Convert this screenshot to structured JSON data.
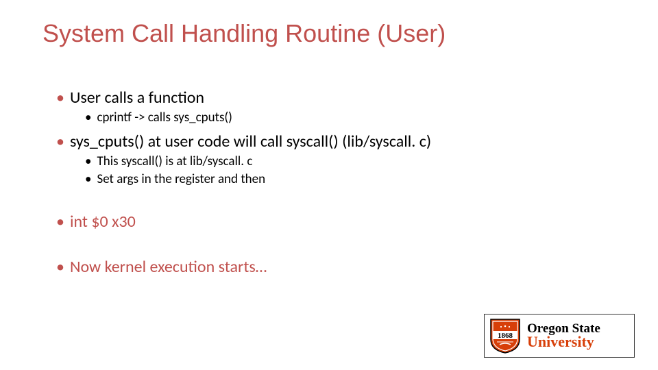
{
  "title": "System Call Handling Routine (User)",
  "bullets": {
    "b1": "User calls a function",
    "b1a": "cprintf -> calls sys_cputs()",
    "b2": "sys_cputs() at user code will call syscall() (lib/syscall. c)",
    "b2a": "This syscall() is at lib/syscall. c",
    "b2b": "Set args in the register and then",
    "b3": "int $0 x30",
    "b4": "Now kernel execution starts…"
  },
  "logo": {
    "line1": "Oregon State",
    "line2": "University"
  },
  "colors": {
    "accent": "#c0504d",
    "osu_orange": "#d73f09",
    "black": "#000000"
  }
}
